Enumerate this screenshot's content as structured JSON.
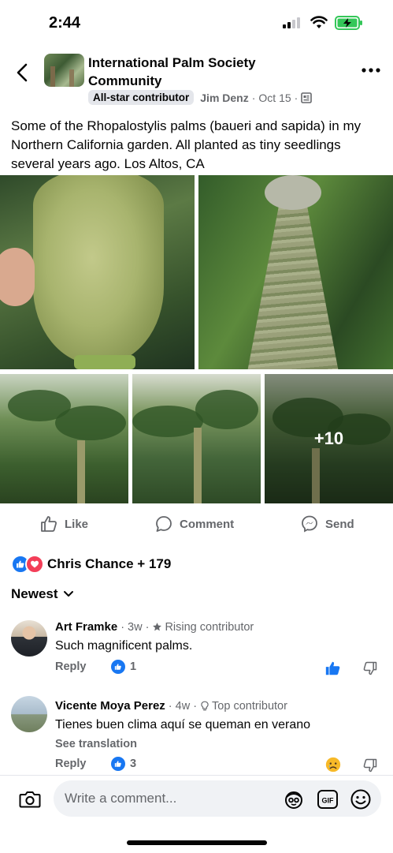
{
  "status": {
    "time": "2:44"
  },
  "group": {
    "name": "International Palm Society Community",
    "badge": "All-star contributor",
    "author": "Jim Denz",
    "date": "Oct 15"
  },
  "post": {
    "caption": "Some of the Rhopalostylis palms (baueri and sapida) in my Northern California garden. All planted as tiny seedlings several years ago. Los Altos, CA",
    "more_photos": "+10"
  },
  "actions": {
    "like": "Like",
    "comment": "Comment",
    "send": "Send"
  },
  "reactions": {
    "summary": "Chris Chance + 179"
  },
  "sort": {
    "label": "Newest"
  },
  "comments": [
    {
      "author": "Art Framke",
      "time": "3w",
      "badge": "Rising contributor",
      "text": "Such magnificent palms.",
      "reply": "Reply",
      "likes": "1"
    },
    {
      "author": "Vicente Moya Perez",
      "time": "4w",
      "badge": "Top contributor",
      "text": "Tienes buen clima aquí se queman en verano",
      "translate": "See translation",
      "reply": "Reply",
      "likes": "3"
    }
  ],
  "composer": {
    "placeholder": "Write a comment...",
    "gif": "GIF"
  },
  "colors": {
    "accent": "#1877f2",
    "love": "#f33e58",
    "battery": "#34c759",
    "muted": "#65676b"
  },
  "icons": [
    "back-icon",
    "more-icon",
    "like-icon",
    "comment-icon",
    "messenger-icon",
    "camera-icon",
    "avatar-sticker-icon",
    "gif-icon",
    "emoji-icon"
  ]
}
